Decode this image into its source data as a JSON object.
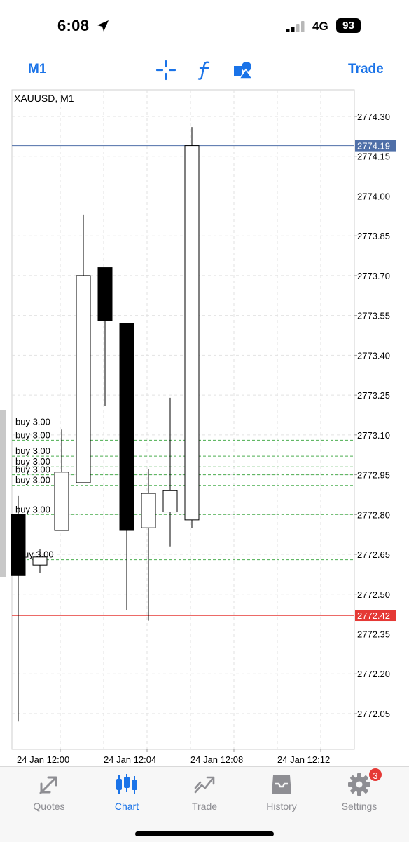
{
  "status_bar": {
    "time": "6:08",
    "network": "4G",
    "battery": "93",
    "location_icon": "location-arrow-icon",
    "signal_icon": "cellular-signal-icon"
  },
  "toolbar": {
    "period_label": "M1",
    "trade_label": "Trade",
    "icons": [
      "crosshair-icon",
      "indicator-f-icon",
      "objects-shapes-icon"
    ],
    "accent_color": "#1a73e8"
  },
  "chart": {
    "symbol_label": "XAUUSD, M1",
    "ask_line_label": "2774.19",
    "bid_line_label": "2772.42",
    "ask_color": "#4f6fa8",
    "bid_color": "#e53935",
    "order_color": "#4caf50"
  },
  "chart_data": {
    "type": "candlestick",
    "symbol": "XAUUSD",
    "timeframe": "M1",
    "ylim": [
      2771.95,
      2774.35
    ],
    "y_ticks": [
      "2774.30",
      "2774.15",
      "2774.00",
      "2773.85",
      "2773.70",
      "2773.55",
      "2773.40",
      "2773.25",
      "2773.10",
      "2772.95",
      "2772.80",
      "2772.65",
      "2772.50",
      "2772.35",
      "2772.20",
      "2772.05"
    ],
    "x_ticks": [
      "24 Jan 12:00",
      "24 Jan 12:04",
      "24 Jan 12:08",
      "24 Jan 12:12"
    ],
    "grid": true,
    "candles": [
      {
        "open": 2772.8,
        "high": 2772.87,
        "low": 2772.02,
        "close": 2772.57
      },
      {
        "open": 2772.61,
        "high": 2772.67,
        "low": 2772.58,
        "close": 2772.64
      },
      {
        "open": 2772.74,
        "high": 2773.12,
        "low": 2772.74,
        "close": 2772.96
      },
      {
        "open": 2772.92,
        "high": 2773.93,
        "low": 2772.92,
        "close": 2773.7
      },
      {
        "open": 2773.73,
        "high": 2773.73,
        "low": 2773.21,
        "close": 2773.53
      },
      {
        "open": 2773.52,
        "high": 2773.52,
        "low": 2772.44,
        "close": 2772.74
      },
      {
        "open": 2772.75,
        "high": 2772.97,
        "low": 2772.4,
        "close": 2772.88
      },
      {
        "open": 2772.81,
        "high": 2773.24,
        "low": 2772.68,
        "close": 2772.89
      },
      {
        "open": 2772.78,
        "high": 2774.26,
        "low": 2772.75,
        "close": 2774.19
      }
    ],
    "ask_price": 2774.19,
    "bid_price": 2772.42,
    "orders": [
      {
        "label": "buy 3.00",
        "price": 2773.13
      },
      {
        "label": "buy 3.00",
        "price": 2773.08
      },
      {
        "label": "buy 3.00",
        "price": 2773.02
      },
      {
        "label": "buy 3.00",
        "price": 2772.98
      },
      {
        "label": "buy 3.00",
        "price": 2772.95
      },
      {
        "label": "buy 3.00",
        "price": 2772.91
      },
      {
        "label": "buy 3.00",
        "price": 2772.8
      },
      {
        "label": "uy 3.00",
        "price": 2772.63
      }
    ]
  },
  "tabbar": {
    "tabs": [
      {
        "label": "Quotes",
        "icon": "quotes-arrows-icon"
      },
      {
        "label": "Chart",
        "icon": "chart-candles-icon"
      },
      {
        "label": "Trade",
        "icon": "trade-trend-icon"
      },
      {
        "label": "History",
        "icon": "history-inbox-icon"
      },
      {
        "label": "Settings",
        "icon": "gear-icon"
      }
    ],
    "settings_badge": "3",
    "active_tab": "Chart"
  }
}
